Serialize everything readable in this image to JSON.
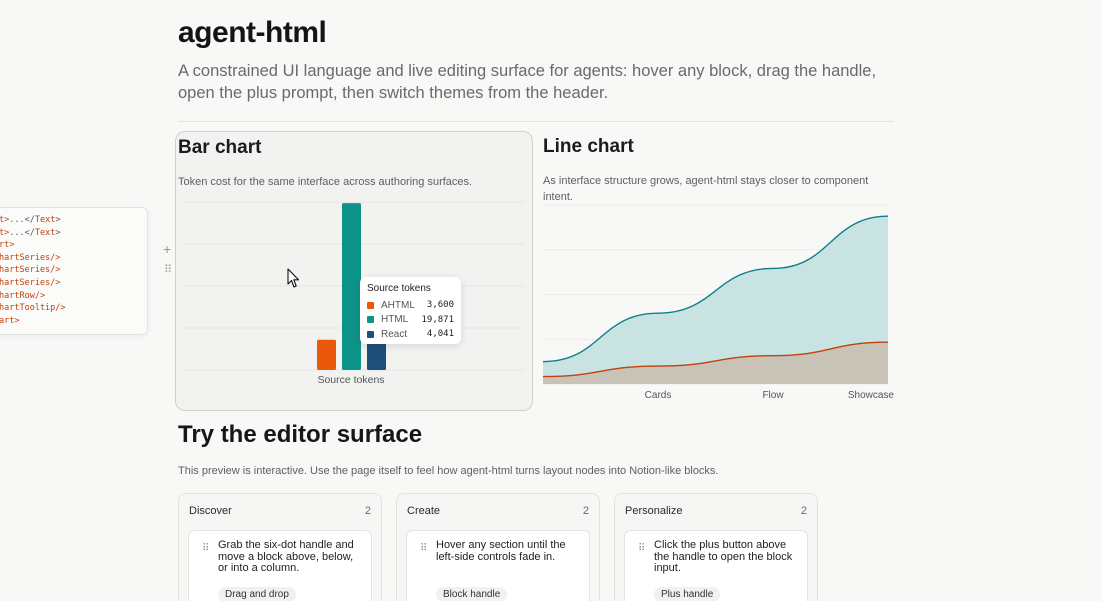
{
  "header": {
    "title": "agent-html",
    "subtitle": "A constrained UI language and live editing surface for agents: hover any block, drag the handle, open the plus prompt, then switch themes from the header."
  },
  "code_popover": {
    "lines": [
      {
        "a": "t>",
        "b": "...</",
        "c": "Text",
        "d": ">"
      },
      {
        "a": "t>",
        "b": "...</",
        "c": "Text",
        "d": ">"
      },
      {
        "a": "rt>",
        "b": "",
        "c": "",
        "d": ""
      },
      {
        "a": "hartSeries/>",
        "b": "",
        "c": "",
        "d": ""
      },
      {
        "a": "hartSeries/>",
        "b": "",
        "c": "",
        "d": ""
      },
      {
        "a": "hartSeries/>",
        "b": "",
        "c": "",
        "d": ""
      },
      {
        "a": "hartRow/>",
        "b": "",
        "c": "",
        "d": ""
      },
      {
        "a": "hartTooltip/>",
        "b": "",
        "c": "",
        "d": ""
      },
      {
        "a": "art>",
        "b": "",
        "c": "",
        "d": ""
      }
    ]
  },
  "bar_card": {
    "title": "Bar chart",
    "desc": "Token cost for the same interface across authoring surfaces.",
    "tooltip": {
      "title": "Source tokens",
      "rows": [
        {
          "name": "AHTML",
          "value": "3,600"
        },
        {
          "name": "HTML",
          "value": "19,871"
        },
        {
          "name": "React",
          "value": "4,041"
        }
      ]
    }
  },
  "line_card": {
    "title": "Line chart",
    "desc": "As interface structure grows, agent-html stays closer to component intent."
  },
  "chart_data": [
    {
      "type": "bar",
      "categories": [
        "Source tokens"
      ],
      "xlabel": "Source tokens",
      "series": [
        {
          "name": "AHTML",
          "values": [
            3600
          ],
          "color": "#ea580c"
        },
        {
          "name": "HTML",
          "values": [
            19871
          ],
          "color": "#0d9488"
        },
        {
          "name": "React",
          "values": [
            4041
          ],
          "color": "#1e4e79"
        }
      ],
      "ylim": [
        0,
        20000
      ],
      "grid": true
    },
    {
      "type": "area",
      "x": [
        "",
        "Cards",
        "Flow",
        "Showcase"
      ],
      "series": [
        {
          "values": [
            3,
            9.5,
            15.5,
            22.5
          ],
          "color": "#0f7f8c",
          "fill": "#c9e3e2"
        },
        {
          "values": [
            1,
            2.4,
            3.8,
            5.6
          ],
          "color": "#c2410c",
          "fill": "#c8c3b6"
        }
      ],
      "ylim": [
        0,
        24
      ],
      "grid": true
    }
  ],
  "editor": {
    "title": "Try the editor surface",
    "desc": "This preview is interactive. Use the page itself to feel how agent-html turns layout nodes into Notion-like blocks.",
    "columns": [
      {
        "name": "Discover",
        "count": "2",
        "item_text": "Grab the six-dot handle and move a block above, below, or into a column.",
        "tag": "Drag and drop"
      },
      {
        "name": "Create",
        "count": "2",
        "item_text": "Hover any section until the left-side controls fade in.",
        "tag": "Block handle"
      },
      {
        "name": "Personalize",
        "count": "2",
        "item_text": "Click the plus button above the handle to open the block input.",
        "tag": "Plus handle"
      }
    ]
  }
}
